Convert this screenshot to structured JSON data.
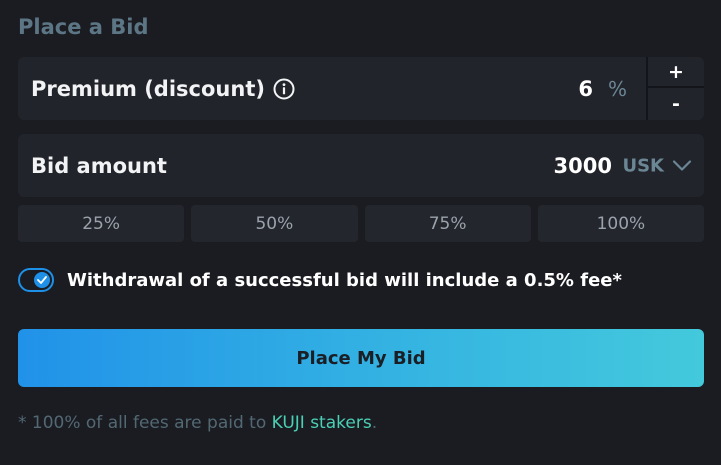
{
  "title": "Place a Bid",
  "premium": {
    "label": "Premium (discount)",
    "info_icon": "info-icon",
    "value": "6",
    "unit": "%",
    "increment_label": "+",
    "decrement_label": "-"
  },
  "bid": {
    "label": "Bid amount",
    "value": "3000",
    "token": "USK",
    "dropdown_icon": "chevron-down-icon"
  },
  "percent_buttons": [
    "25%",
    "50%",
    "75%",
    "100%"
  ],
  "fee_toggle": {
    "checked": true,
    "label": "Withdrawal of a successful bid will include a 0.5% fee*"
  },
  "submit_label": "Place My Bid",
  "footnote": {
    "prefix": "* 100% of all fees are paid to ",
    "link": "KUJI stakers",
    "suffix": "."
  },
  "colors": {
    "background": "#1b1c22",
    "panel": "#22242b",
    "accent": "#1e90e8",
    "link": "#4ad0b5",
    "title": "#5d7685"
  }
}
